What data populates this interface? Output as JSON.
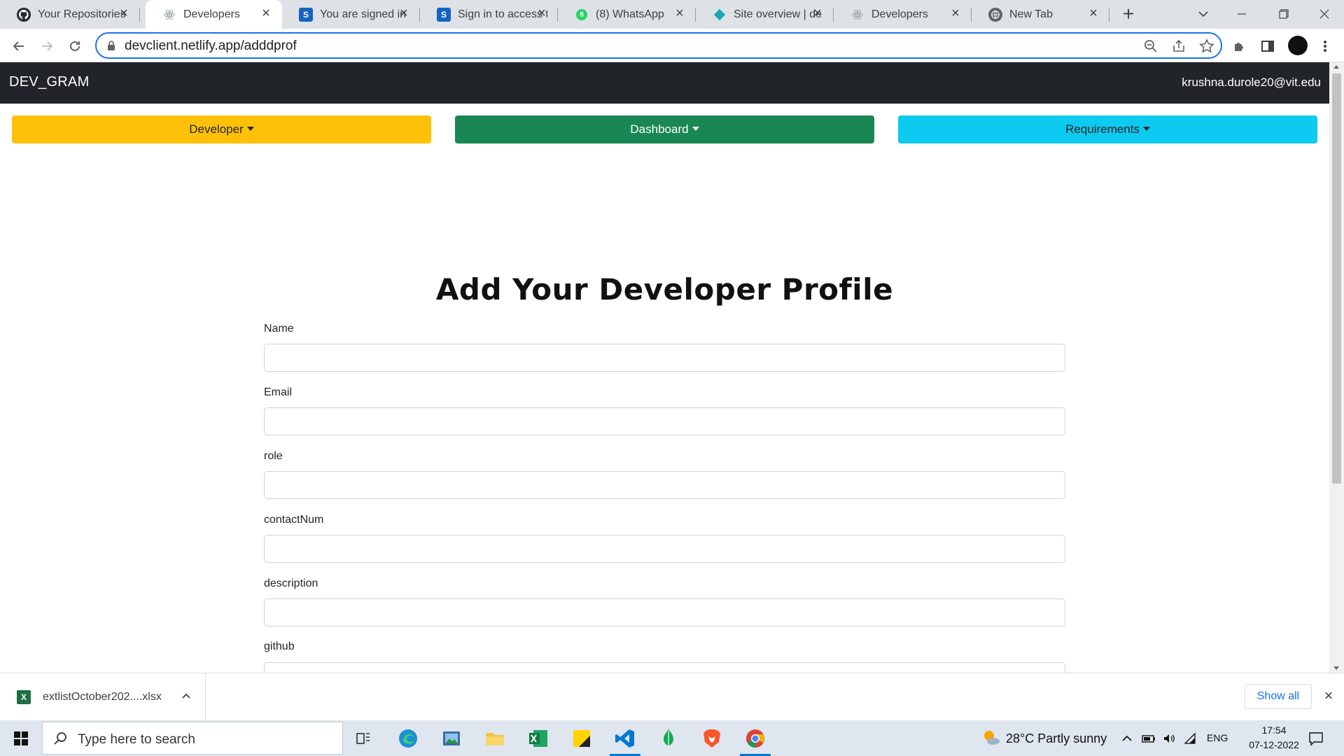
{
  "browser": {
    "tabs": [
      {
        "title": "Your Repositories",
        "icon": "github-icon",
        "color": "#24292f"
      },
      {
        "title": "Developers",
        "icon": "react-icon",
        "color": "#9aa0a6"
      },
      {
        "title": "You are signed in",
        "icon": "s-logo-icon",
        "color": "#1565c0"
      },
      {
        "title": "Sign in to access t",
        "icon": "s-logo-icon",
        "color": "#1565c0"
      },
      {
        "title": "(8) WhatsApp",
        "icon": "whatsapp-icon",
        "color": "#25d366",
        "badge": "8"
      },
      {
        "title": "Site overview | de",
        "icon": "netlify-icon",
        "color": "#15a9b5"
      },
      {
        "title": "Developers",
        "icon": "react-icon",
        "color": "#9aa0a6"
      },
      {
        "title": "New Tab",
        "icon": "globe-icon",
        "color": "#5f6368"
      }
    ],
    "active_tab": 1,
    "url": "devclient.netlify.app/adddprof"
  },
  "app": {
    "brand": "DEV_GRAM",
    "user_email": "krushna.durole20@vit.edu",
    "menus": {
      "developer": "Developer",
      "dashboard": "Dashboard",
      "requirements": "Requirements"
    },
    "colors": {
      "developer": "#ffc107",
      "dashboard": "#198754",
      "requirements": "#0dcaf0"
    }
  },
  "form": {
    "title": "Add Your Developer Profile",
    "fields": [
      {
        "label": "Name",
        "value": ""
      },
      {
        "label": "Email",
        "value": ""
      },
      {
        "label": "role",
        "value": ""
      },
      {
        "label": "contactNum",
        "value": ""
      },
      {
        "label": "description",
        "value": ""
      },
      {
        "label": "github",
        "value": ""
      }
    ]
  },
  "downloads": {
    "file_name": "extlistOctober202....xlsx",
    "show_all": "Show all"
  },
  "taskbar": {
    "search_placeholder": "Type here to search",
    "weather": "28°C  Partly sunny",
    "language": "ENG",
    "time": "17:54",
    "date": "07-12-2022"
  }
}
